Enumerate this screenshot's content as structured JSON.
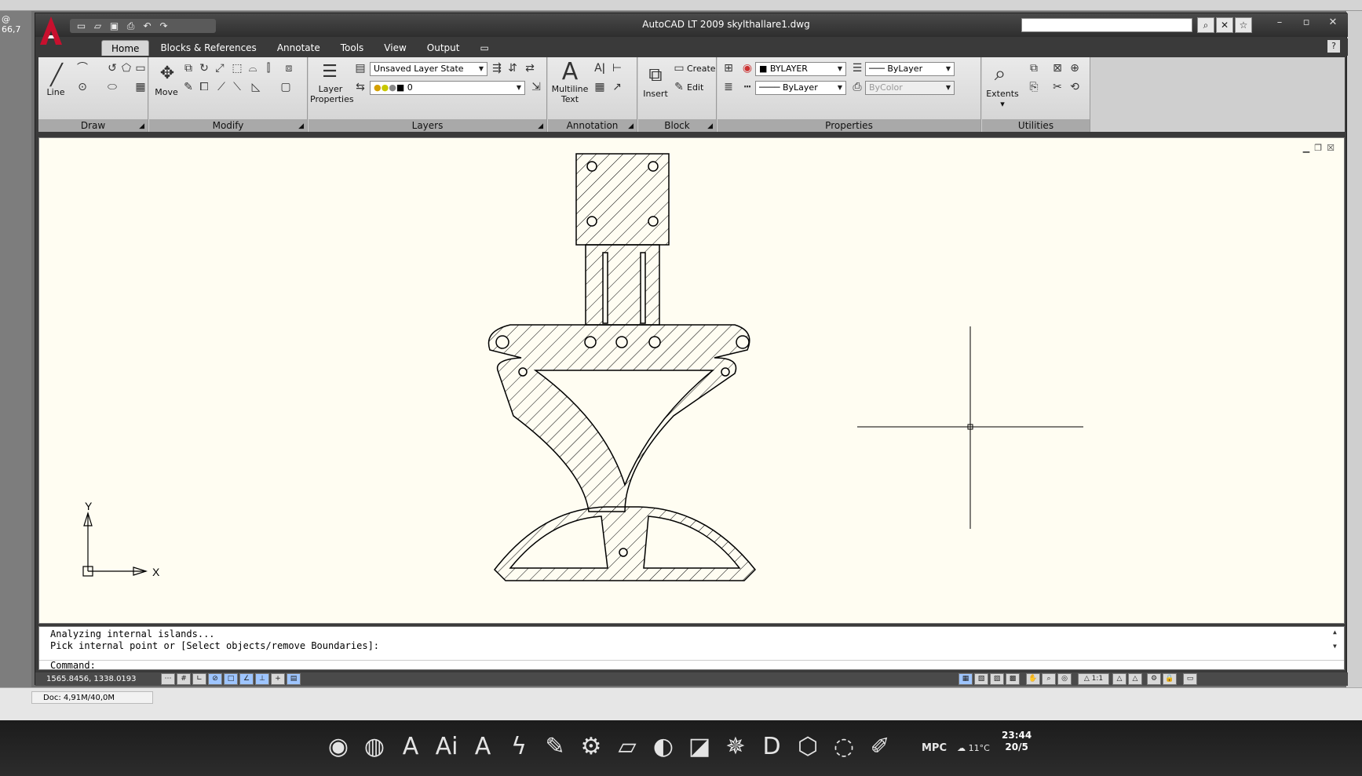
{
  "background": {
    "zoom_text": "@ 66,7",
    "doc_memory": "Doc: 4,91M/40,0M"
  },
  "window": {
    "title": "AutoCAD LT 2009 skylthallare1.dwg",
    "help_label": "?",
    "qat_icons": [
      "new-icon",
      "open-icon",
      "save-icon",
      "print-icon",
      "undo-icon",
      "redo-icon"
    ]
  },
  "ribbon": {
    "tabs": [
      {
        "label": "Home",
        "active": true
      },
      {
        "label": "Blocks & References",
        "active": false
      },
      {
        "label": "Annotate",
        "active": false
      },
      {
        "label": "Tools",
        "active": false
      },
      {
        "label": "View",
        "active": false
      },
      {
        "label": "Output",
        "active": false
      }
    ],
    "panels": {
      "draw": {
        "title": "Draw",
        "line_label": "Line"
      },
      "modify": {
        "title": "Modify",
        "move_label": "Move"
      },
      "layers": {
        "title": "Layers",
        "layer_properties_label": "Layer Properties",
        "layer_state": "Unsaved Layer State",
        "current_layer": "0"
      },
      "annotation": {
        "title": "Annotation",
        "mtext_label": "Multiline Text"
      },
      "block": {
        "title": "Block",
        "insert_label": "Insert",
        "create_label": "Create",
        "edit_label": "Edit"
      },
      "properties": {
        "title": "Properties",
        "color": "BYLAYER",
        "lineweight": "ByLayer",
        "linetype": "ByLayer",
        "plotstyle": "ByColor"
      },
      "utilities": {
        "title": "Utilities",
        "extents_label": "Extents"
      }
    }
  },
  "canvas": {
    "ucs_x_label": "X",
    "ucs_y_label": "Y"
  },
  "command": {
    "history": [
      "Analyzing internal islands...",
      "Pick internal point or [Select objects/remove Boundaries]:"
    ],
    "prompt": "Command:"
  },
  "status": {
    "coordinates": "1565.8456, 1338.0193",
    "scale": "1:1"
  },
  "taskbar": {
    "time": "23:44",
    "date": "20/5",
    "temperature": "11°C",
    "mpc_label": "MPC"
  },
  "colors": {
    "canvas_bg": "#fffdf2",
    "window_dark": "#3a3a3a",
    "ribbon_bg": "#d2d2d2",
    "autocad_red": "#c8102e"
  }
}
